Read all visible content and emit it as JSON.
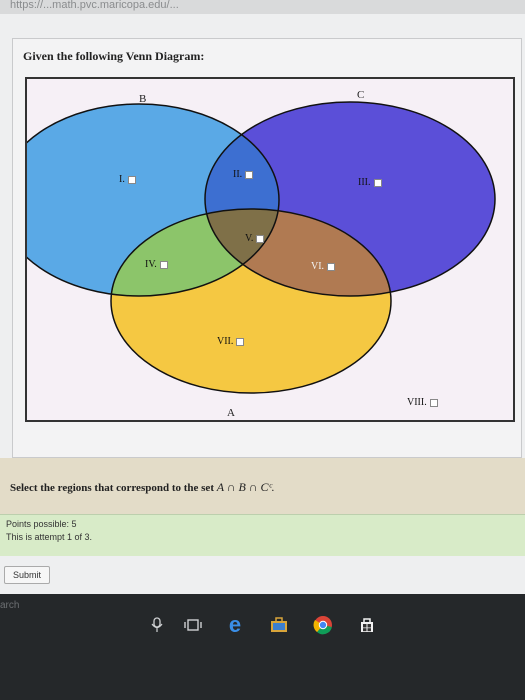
{
  "browser": {
    "url_fragment": "https://...math.pvc.maricopa.edu/..."
  },
  "question": {
    "heading": "Given the following Venn Diagram:",
    "sets": {
      "a": "A",
      "b": "B",
      "c": "C"
    },
    "regions": [
      "I.",
      "II.",
      "III.",
      "IV.",
      "V.",
      "VI.",
      "VII.",
      "VIII."
    ],
    "prompt_text": "Select the regions that correspond to the set",
    "prompt_math": "A ∩ B ∩ Cᶜ."
  },
  "info": {
    "points": "Points possible: 5",
    "attempt": "This is attempt 1 of 3."
  },
  "submit_label": "Submit",
  "taskbar": {
    "search_text": "arch",
    "icons": [
      "microphone-icon",
      "task-view-icon",
      "edge-icon",
      "store-icon",
      "chrome-icon",
      "windows-store-icon"
    ]
  },
  "colors": {
    "circle_b": "#5aa9e6",
    "circle_c": "#5b4fd8",
    "circle_a": "#f5c842",
    "overlap_bc": "#3d6fd1",
    "overlap_ab": "#8cc56a",
    "overlap_ac": "#b07a52",
    "overlap_abc": "#7f7048"
  }
}
